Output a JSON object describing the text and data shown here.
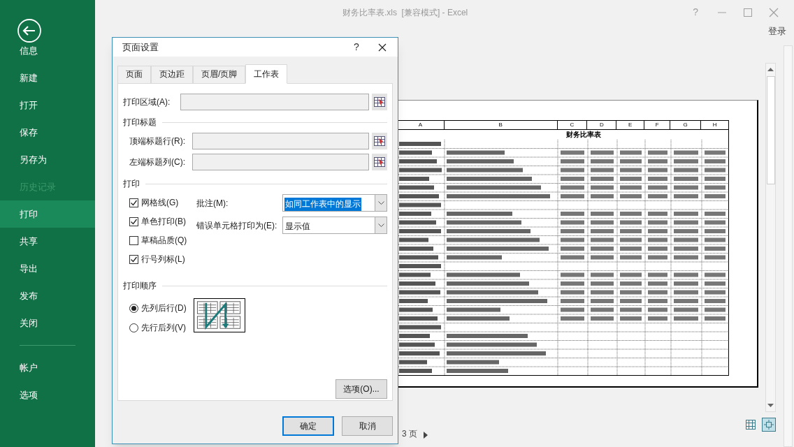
{
  "window": {
    "title": "财务比率表.xls  [兼容模式] - Excel",
    "help": "?",
    "sign_in": "登录"
  },
  "sidebar": {
    "items": [
      {
        "label": "信息",
        "selected": false,
        "disabled": false
      },
      {
        "label": "新建",
        "selected": false,
        "disabled": false
      },
      {
        "label": "打开",
        "selected": false,
        "disabled": false
      },
      {
        "label": "保存",
        "selected": false,
        "disabled": false
      },
      {
        "label": "另存为",
        "selected": false,
        "disabled": false
      },
      {
        "label": "历史记录",
        "selected": false,
        "disabled": true
      },
      {
        "label": "打印",
        "selected": true,
        "disabled": false
      },
      {
        "label": "共享",
        "selected": false,
        "disabled": false
      },
      {
        "label": "导出",
        "selected": false,
        "disabled": false
      },
      {
        "label": "发布",
        "selected": false,
        "disabled": false
      },
      {
        "label": "关闭",
        "selected": false,
        "disabled": false
      }
    ],
    "footer_items": [
      {
        "label": "帐户",
        "selected": false,
        "disabled": false
      },
      {
        "label": "选项",
        "selected": false,
        "disabled": false
      }
    ]
  },
  "preview": {
    "title": "财务比率表",
    "columns": [
      "A",
      "B",
      "C",
      "D",
      "E",
      "F",
      "G",
      "H"
    ],
    "page_nav": "3 页"
  },
  "dialog": {
    "title": "页面设置",
    "help": "?",
    "tabs": [
      {
        "label": "页面",
        "selected": false
      },
      {
        "label": "页边距",
        "selected": false
      },
      {
        "label": "页眉/页脚",
        "selected": false
      },
      {
        "label": "工作表",
        "selected": true
      }
    ],
    "print_area": {
      "label": "打印区域(A):"
    },
    "print_titles": {
      "heading": "打印标题",
      "fields": [
        {
          "label": "顶端标题行(R):"
        },
        {
          "label": "左端标题列(C):"
        }
      ]
    },
    "print": {
      "heading": "打印",
      "checkboxes": [
        {
          "label": "网格线(G)",
          "checked": true
        },
        {
          "label": "单色打印(B)",
          "checked": true
        },
        {
          "label": "草稿品质(Q)",
          "checked": false
        },
        {
          "label": "行号列标(L)",
          "checked": true
        }
      ],
      "selects": [
        {
          "label": "批注(M):",
          "value": "如同工作表中的显示",
          "highlighted": true
        },
        {
          "label": "错误单元格打印为(E):",
          "value": "显示值",
          "highlighted": false
        }
      ]
    },
    "print_order": {
      "heading": "打印顺序",
      "options": [
        {
          "label": "先列后行(D)",
          "selected": true
        },
        {
          "label": "先行后列(V)",
          "selected": false
        }
      ]
    },
    "options_button": "选项(O)...",
    "ok_button": "确定",
    "cancel_button": "取消"
  }
}
